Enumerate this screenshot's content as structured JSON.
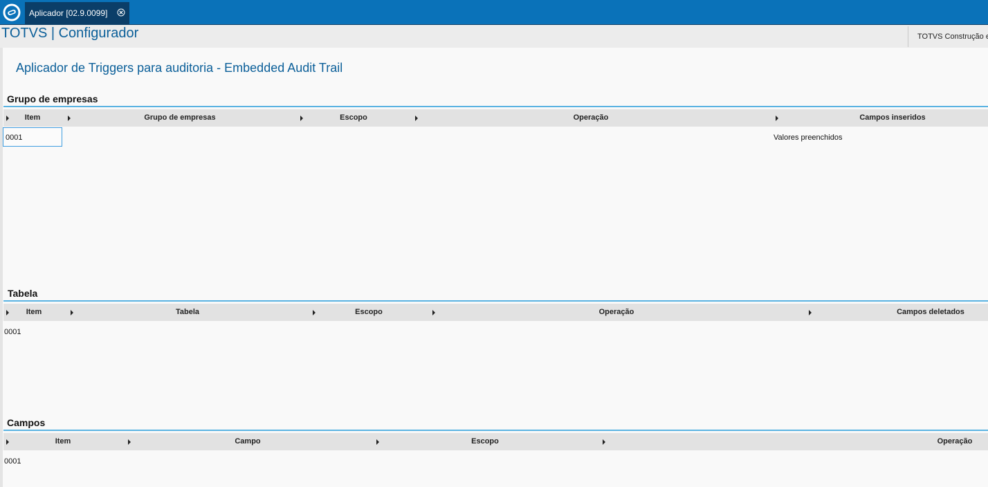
{
  "topbar": {
    "tab_label": "Aplicador [02.9.0099]",
    "accent": "#0a72b9",
    "tab_color": "#0b3e68"
  },
  "header": {
    "title": "TOTVS | Configurador",
    "company": "TOTVS Construção e"
  },
  "page": {
    "title": "Aplicador de Triggers para auditoria - Embedded Audit Trail"
  },
  "sections": {
    "grupo": {
      "title": "Grupo de empresas",
      "columns": [
        "Item",
        "Grupo de empresas",
        "Escopo",
        "Operação",
        "Campos inseridos"
      ],
      "row": {
        "item": "0001",
        "campos": "Valores preenchidos"
      }
    },
    "tabela": {
      "title": "Tabela",
      "columns": [
        "Item",
        "Tabela",
        "Escopo",
        "Operação",
        "Campos deletados"
      ],
      "row": {
        "item": "0001"
      }
    },
    "campos": {
      "title": "Campos",
      "columns": [
        "Item",
        "Campo",
        "Escopo",
        "Operação"
      ],
      "row": {
        "item": "0001"
      }
    }
  }
}
